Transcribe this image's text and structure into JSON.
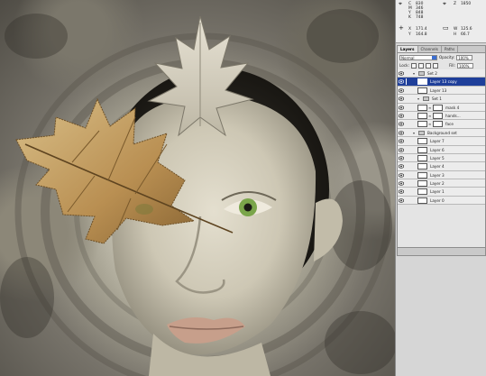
{
  "info_panel": {
    "readouts": [
      {
        "label": "C",
        "value": "830"
      },
      {
        "label": "M",
        "value": "346"
      },
      {
        "label": "Y",
        "value": "848"
      },
      {
        "label": "K",
        "value": "748"
      },
      {
        "label": "X",
        "value": "171.4"
      },
      {
        "label": "Y",
        "value": "164.8"
      },
      {
        "label": "W",
        "value": "125.6"
      },
      {
        "label": "H",
        "value": "66.7"
      }
    ],
    "right_top": {
      "label": "Z",
      "value": "1850"
    }
  },
  "layers_panel": {
    "tabs": [
      "Layers",
      "Channels",
      "Paths"
    ],
    "blend_mode": "Normal",
    "opacity_label": "Opacity:",
    "opacity_value": "100%",
    "lock_label": "Lock:",
    "fill_label": "Fill:",
    "fill_value": "100%",
    "layers": [
      {
        "name": "Set 2",
        "kind": "set",
        "indent": 0,
        "selected": false
      },
      {
        "name": "Layer 13 copy",
        "kind": "layer",
        "indent": 1,
        "selected": true
      },
      {
        "name": "Layer 13",
        "kind": "layer",
        "indent": 1,
        "selected": false
      },
      {
        "name": "Set 1",
        "kind": "set",
        "indent": 1,
        "selected": false
      },
      {
        "name": "mask 4",
        "kind": "masked",
        "indent": 1,
        "selected": false
      },
      {
        "name": "hands...",
        "kind": "masked",
        "indent": 1,
        "selected": false
      },
      {
        "name": "face",
        "kind": "masked",
        "indent": 1,
        "selected": false
      },
      {
        "name": "Background set",
        "kind": "set",
        "indent": 0,
        "selected": false
      },
      {
        "name": "Layer 7",
        "kind": "layer",
        "indent": 1,
        "selected": false
      },
      {
        "name": "Layer 6",
        "kind": "layer",
        "indent": 1,
        "selected": false
      },
      {
        "name": "Layer 5",
        "kind": "layer",
        "indent": 1,
        "selected": false
      },
      {
        "name": "Layer 4",
        "kind": "layer",
        "indent": 1,
        "selected": false
      },
      {
        "name": "Layer 3",
        "kind": "layer",
        "indent": 1,
        "selected": false
      },
      {
        "name": "Layer 2",
        "kind": "layer",
        "indent": 1,
        "selected": false
      },
      {
        "name": "Layer 1",
        "kind": "layer",
        "indent": 1,
        "selected": false
      },
      {
        "name": "Layer 0",
        "kind": "layer",
        "indent": 1,
        "selected": false
      }
    ]
  },
  "colors": {
    "selection": "#1f3f9a",
    "panel_bg": "#e4e4e4",
    "leaf": "#c9a86a",
    "iris": "#7aa54a"
  }
}
